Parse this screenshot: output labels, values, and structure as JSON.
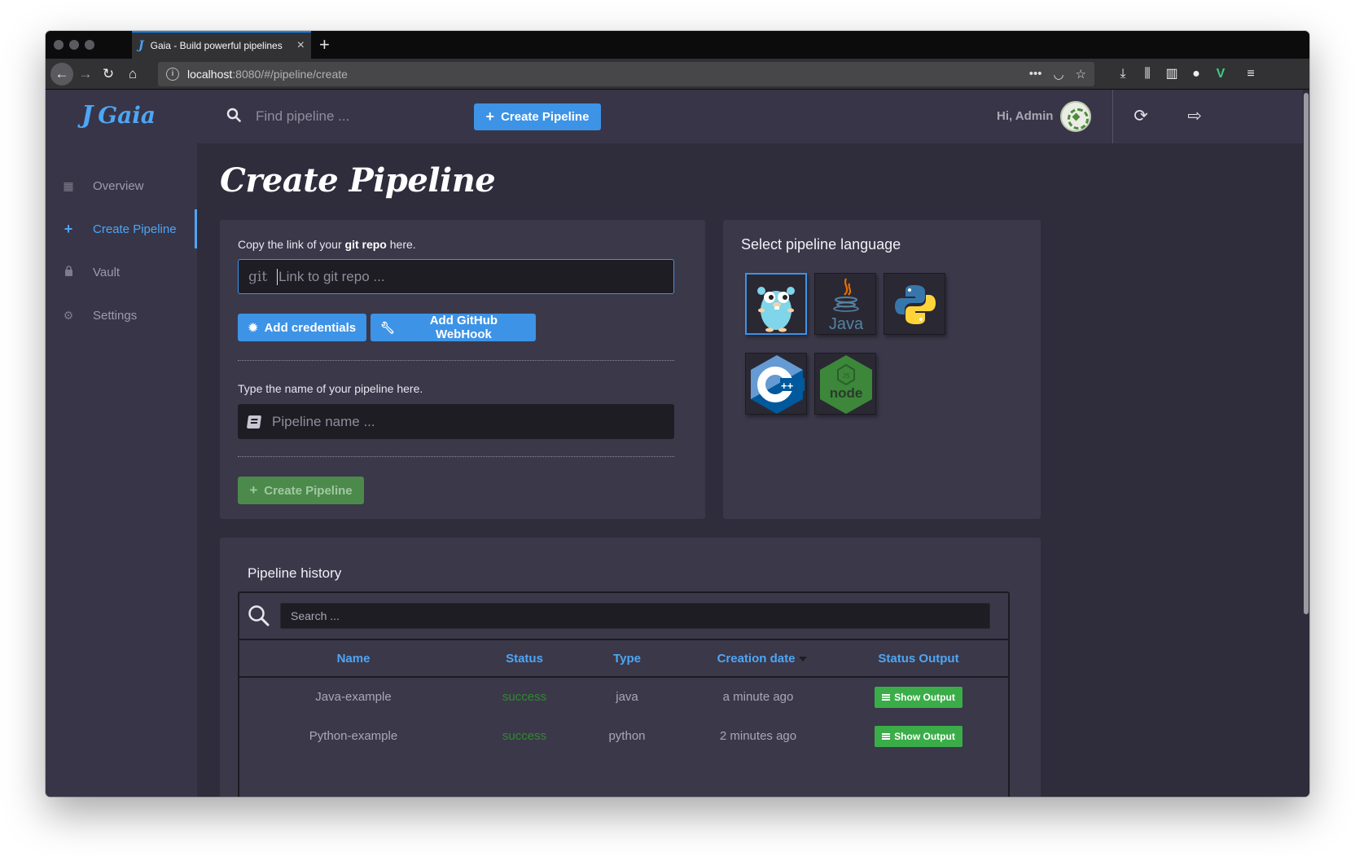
{
  "browser": {
    "tab_title": "Gaia - Build powerful pipelines",
    "url_host": "localhost",
    "url_path": ":8080/#/pipeline/create"
  },
  "sidebar": {
    "brand": "Gaia",
    "items": [
      {
        "label": "Overview",
        "icon": "grid-icon"
      },
      {
        "label": "Create Pipeline",
        "icon": "plus-icon",
        "active": true
      },
      {
        "label": "Vault",
        "icon": "lock-icon"
      },
      {
        "label": "Settings",
        "icon": "gears-icon"
      }
    ]
  },
  "topbar": {
    "search_placeholder": "Find pipeline ...",
    "create_button": "Create Pipeline",
    "greeting": "Hi, Admin"
  },
  "page": {
    "title": "Create Pipeline"
  },
  "form": {
    "git_label_pre": "Copy the link of your ",
    "git_label_bold": "git repo",
    "git_label_post": " here.",
    "git_prefix": "git",
    "git_placeholder": "Link to git repo ...",
    "add_credentials": "Add credentials",
    "add_webhook": "Add GitHub WebHook",
    "name_label": "Type the name of your pipeline here.",
    "name_placeholder": "Pipeline name ...",
    "create_button": "Create Pipeline"
  },
  "languages": {
    "title": "Select pipeline language",
    "options": [
      {
        "name": "go",
        "selected": true
      },
      {
        "name": "java",
        "text": "Java",
        "selected": false
      },
      {
        "name": "python",
        "selected": false
      },
      {
        "name": "cpp",
        "text": "C",
        "badge": "++",
        "selected": false
      },
      {
        "name": "nodejs",
        "text": "node",
        "badge": "JS",
        "selected": false
      }
    ]
  },
  "history": {
    "title": "Pipeline history",
    "search_placeholder": "Search ...",
    "columns": [
      "Name",
      "Status",
      "Type",
      "Creation date",
      "Status Output"
    ],
    "rows": [
      {
        "name": "Java-example",
        "status": "success",
        "type": "java",
        "created": "a minute ago",
        "action": "Show Output"
      },
      {
        "name": "Python-example",
        "status": "success",
        "type": "python",
        "created": "2 minutes ago",
        "action": "Show Output"
      }
    ]
  },
  "colors": {
    "accent": "#3d93e6",
    "sidebar_bg": "#383548",
    "content_bg": "#2f2c3c",
    "panel_bg": "#3b3849",
    "success": "#3aad48"
  }
}
